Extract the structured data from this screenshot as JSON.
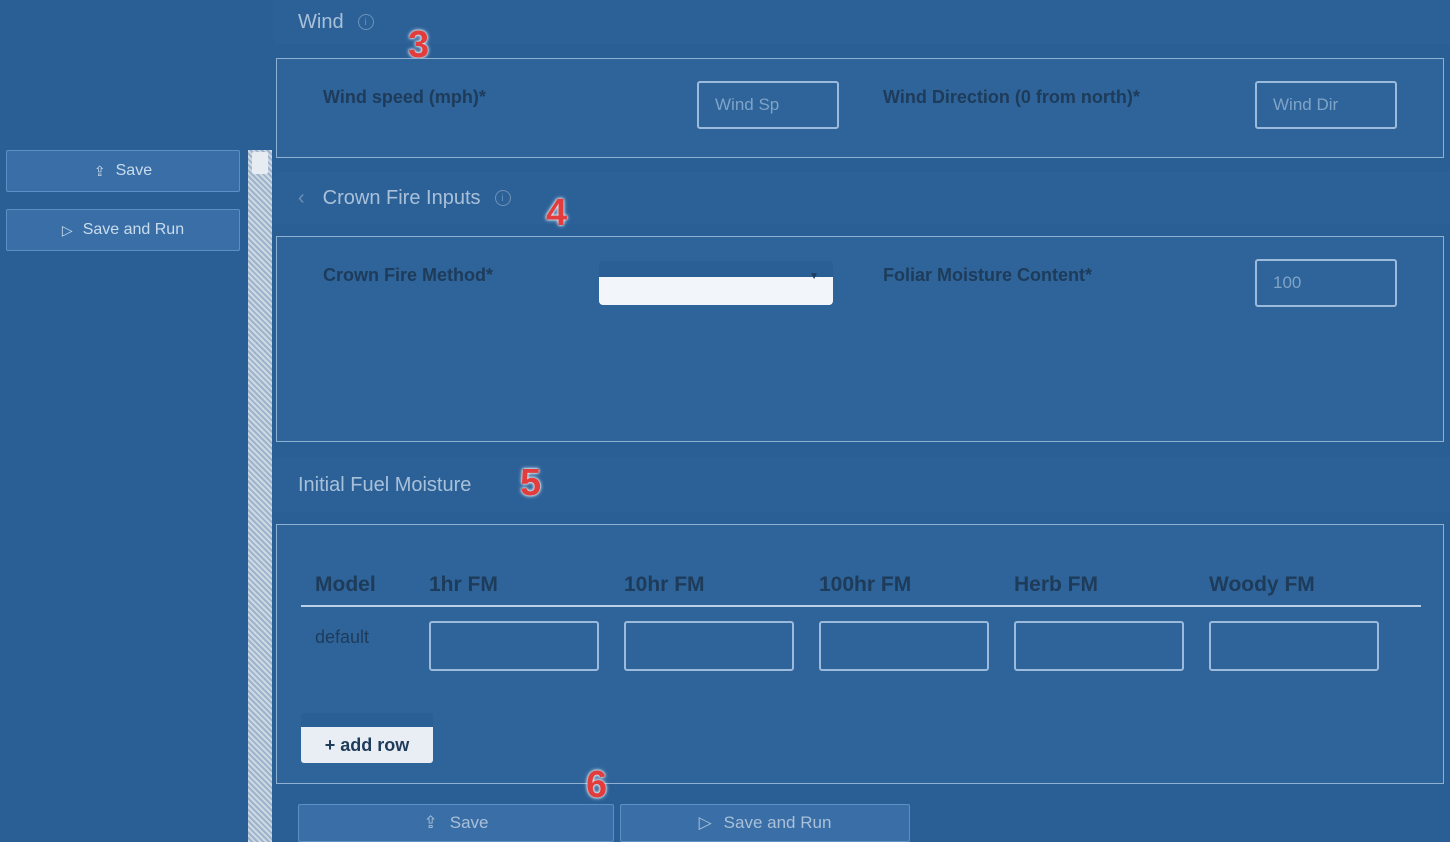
{
  "sidebar": {
    "save_label": "Save",
    "save_run_label": "Save and Run"
  },
  "wind": {
    "title": "Wind",
    "step": "3",
    "speed_label": "Wind speed (mph)*",
    "speed_placeholder": "Wind Sp",
    "direction_label": "Wind Direction (0 from north)*",
    "direction_placeholder": "Wind Dir"
  },
  "crown": {
    "title": "Crown Fire Inputs",
    "step": "4",
    "method_label": "Crown Fire Method*",
    "foliar_label": "Foliar Moisture Content*",
    "foliar_value": "100"
  },
  "fuel": {
    "title": "Initial Fuel Moisture",
    "step": "5",
    "columns": [
      "Model",
      "1hr FM",
      "10hr FM",
      "100hr FM",
      "Herb FM",
      "Woody FM"
    ],
    "row_label": "default",
    "add_row_label": "+ add row"
  },
  "footer": {
    "step": "6",
    "save_label": "Save",
    "save_run_label": "Save and Run"
  }
}
